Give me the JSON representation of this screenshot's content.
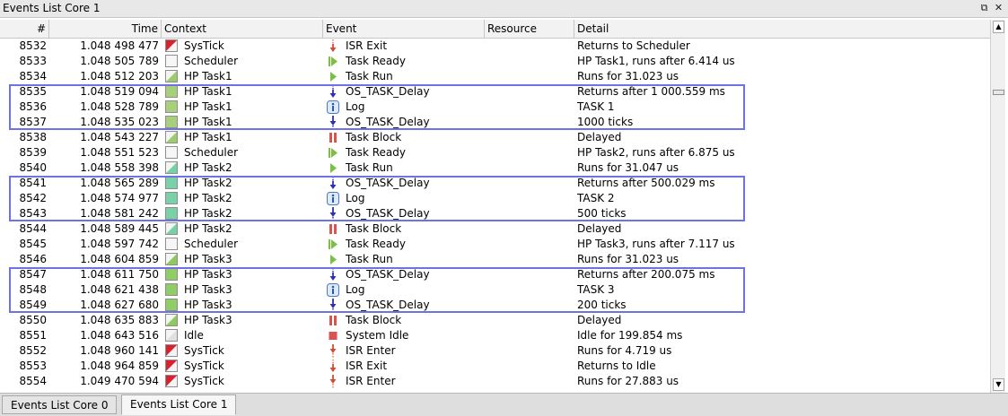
{
  "window": {
    "title": "Events List Core 1"
  },
  "columns": {
    "num": "#",
    "time": "Time",
    "context": "Context",
    "event": "Event",
    "resource": "Resource",
    "detail": "Detail"
  },
  "rows": [
    {
      "num": "8532",
      "time": "1.048 498 477",
      "context": "SysTick",
      "ctx_icon": "systick-icon",
      "event": "ISR Exit",
      "event_icon": "isr-exit-icon",
      "resource": "",
      "detail": "Returns to Scheduler"
    },
    {
      "num": "8533",
      "time": "1.048 505 789",
      "context": "Scheduler",
      "ctx_icon": "scheduler-icon",
      "event": "Task Ready",
      "event_icon": "task-ready-icon",
      "resource": "",
      "detail": "HP Task1, runs after 6.414 us"
    },
    {
      "num": "8534",
      "time": "1.048 512 203",
      "context": "HP Task1",
      "ctx_icon": "task1-icon",
      "event": "Task Run",
      "event_icon": "task-run-icon",
      "resource": "",
      "detail": "Runs for 31.023 us"
    },
    {
      "num": "8535",
      "time": "1.048 519 094",
      "context": "HP Task1",
      "ctx_icon": "task1-full-icon",
      "event": "OS_TASK_Delay",
      "event_icon": "api-call-icon",
      "resource": "",
      "detail": "Returns after 1 000.559 ms"
    },
    {
      "num": "8536",
      "time": "1.048 528 789",
      "context": "HP Task1",
      "ctx_icon": "task1-full-icon",
      "event": "Log",
      "event_icon": "log-info-icon",
      "resource": "",
      "detail": "TASK 1"
    },
    {
      "num": "8537",
      "time": "1.048 535 023",
      "context": "HP Task1",
      "ctx_icon": "task1-full-icon",
      "event": "OS_TASK_Delay",
      "event_icon": "api-return-icon",
      "resource": "",
      "detail": "1000 ticks"
    },
    {
      "num": "8538",
      "time": "1.048 543 227",
      "context": "HP Task1",
      "ctx_icon": "task1-icon",
      "event": "Task Block",
      "event_icon": "task-block-icon",
      "resource": "",
      "detail": "Delayed"
    },
    {
      "num": "8539",
      "time": "1.048 551 523",
      "context": "Scheduler",
      "ctx_icon": "scheduler-icon",
      "event": "Task Ready",
      "event_icon": "task-ready-icon",
      "resource": "",
      "detail": "HP Task2, runs after 6.875 us"
    },
    {
      "num": "8540",
      "time": "1.048 558 398",
      "context": "HP Task2",
      "ctx_icon": "task2-icon",
      "event": "Task Run",
      "event_icon": "task-run-icon",
      "resource": "",
      "detail": "Runs for 31.047 us"
    },
    {
      "num": "8541",
      "time": "1.048 565 289",
      "context": "HP Task2",
      "ctx_icon": "task2-full-icon",
      "event": "OS_TASK_Delay",
      "event_icon": "api-call-icon",
      "resource": "",
      "detail": "Returns after 500.029 ms"
    },
    {
      "num": "8542",
      "time": "1.048 574 977",
      "context": "HP Task2",
      "ctx_icon": "task2-full-icon",
      "event": "Log",
      "event_icon": "log-info-icon",
      "resource": "",
      "detail": "TASK 2"
    },
    {
      "num": "8543",
      "time": "1.048 581 242",
      "context": "HP Task2",
      "ctx_icon": "task2-full-icon",
      "event": "OS_TASK_Delay",
      "event_icon": "api-return-icon",
      "resource": "",
      "detail": "500 ticks"
    },
    {
      "num": "8544",
      "time": "1.048 589 445",
      "context": "HP Task2",
      "ctx_icon": "task2-icon",
      "event": "Task Block",
      "event_icon": "task-block-icon",
      "resource": "",
      "detail": "Delayed"
    },
    {
      "num": "8545",
      "time": "1.048 597 742",
      "context": "Scheduler",
      "ctx_icon": "scheduler-icon",
      "event": "Task Ready",
      "event_icon": "task-ready-icon",
      "resource": "",
      "detail": "HP Task3, runs after 7.117 us"
    },
    {
      "num": "8546",
      "time": "1.048 604 859",
      "context": "HP Task3",
      "ctx_icon": "task3-icon",
      "event": "Task Run",
      "event_icon": "task-run-icon",
      "resource": "",
      "detail": "Runs for 31.023 us"
    },
    {
      "num": "8547",
      "time": "1.048 611 750",
      "context": "HP Task3",
      "ctx_icon": "task3-full-icon",
      "event": "OS_TASK_Delay",
      "event_icon": "api-call-icon",
      "resource": "",
      "detail": "Returns after 200.075 ms"
    },
    {
      "num": "8548",
      "time": "1.048 621 438",
      "context": "HP Task3",
      "ctx_icon": "task3-full-icon",
      "event": "Log",
      "event_icon": "log-info-icon",
      "resource": "",
      "detail": "TASK 3"
    },
    {
      "num": "8549",
      "time": "1.048 627 680",
      "context": "HP Task3",
      "ctx_icon": "task3-full-icon",
      "event": "OS_TASK_Delay",
      "event_icon": "api-return-icon",
      "resource": "",
      "detail": "200 ticks"
    },
    {
      "num": "8550",
      "time": "1.048 635 883",
      "context": "HP Task3",
      "ctx_icon": "task3-icon",
      "event": "Task Block",
      "event_icon": "task-block-icon",
      "resource": "",
      "detail": "Delayed"
    },
    {
      "num": "8551",
      "time": "1.048 643 516",
      "context": "Idle",
      "ctx_icon": "idle-icon",
      "event": "System Idle",
      "event_icon": "system-idle-icon",
      "resource": "",
      "detail": "Idle for 199.854 ms"
    },
    {
      "num": "8552",
      "time": "1.048 960 141",
      "context": "SysTick",
      "ctx_icon": "systick-icon",
      "event": "ISR Enter",
      "event_icon": "isr-enter-icon",
      "resource": "",
      "detail": "Runs for 4.719 us"
    },
    {
      "num": "8553",
      "time": "1.048 964 859",
      "context": "SysTick",
      "ctx_icon": "systick-icon",
      "event": "ISR Exit",
      "event_icon": "isr-exit-icon",
      "resource": "",
      "detail": "Returns to Idle"
    },
    {
      "num": "8554",
      "time": "1.049 470 594",
      "context": "SysTick",
      "ctx_icon": "systick-icon",
      "event": "ISR Enter",
      "event_icon": "isr-enter-icon",
      "resource": "",
      "detail": "Runs for 27.883 us"
    }
  ],
  "tabs": [
    {
      "label": "Events List Core 0",
      "active": false
    },
    {
      "label": "Events List Core 1",
      "active": true
    }
  ],
  "colors": {
    "highlight_box": "#6d73e6"
  }
}
